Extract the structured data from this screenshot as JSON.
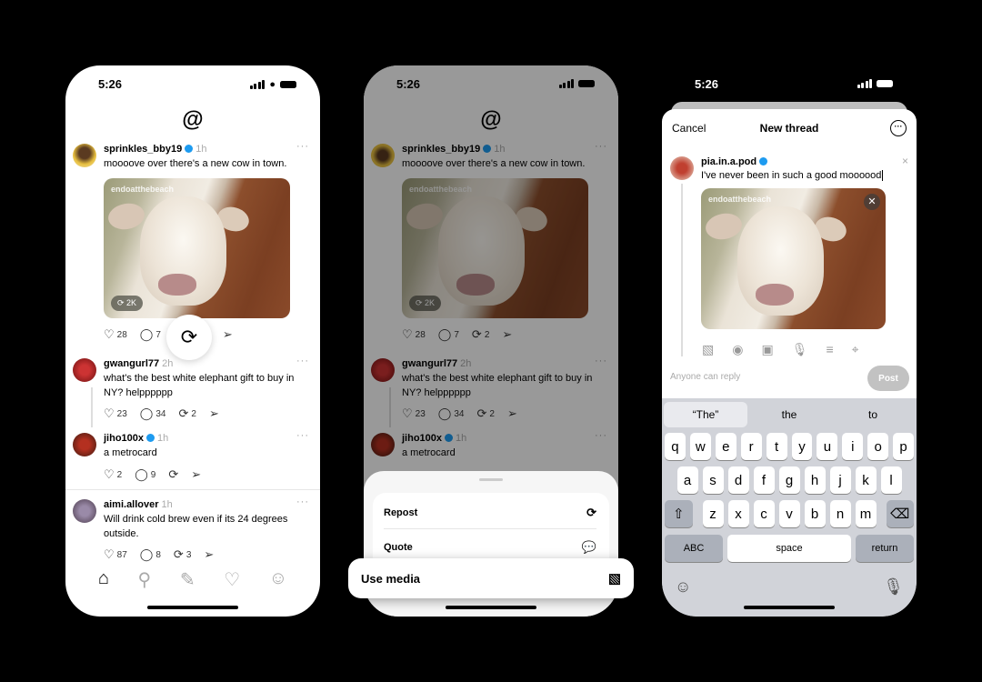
{
  "status_time": "5:26",
  "feed": {
    "posts": [
      {
        "user": "sprinkles_bby19",
        "verified": true,
        "time": "1h",
        "text": "moooove over there's a new cow in town.",
        "media_watermark": "endoatthebeach",
        "media_badge": "2K",
        "likes": "28",
        "replies": "7",
        "reposts": "2"
      },
      {
        "user": "gwangurl77",
        "verified": false,
        "time": "2h",
        "text": "what's the best white elephant gift to buy in NY? helpppppp",
        "likes": "23",
        "replies": "34",
        "reposts": "2"
      },
      {
        "user": "jiho100x",
        "verified": true,
        "time": "1h",
        "text": "a metrocard",
        "likes": "2",
        "replies": "9",
        "reposts": ""
      },
      {
        "user": "aimi.allover",
        "verified": false,
        "time": "1h",
        "text": "Will drink cold brew even if its 24 degrees outside.",
        "likes": "87",
        "replies": "8",
        "reposts": "3"
      }
    ],
    "tabs": [
      "home",
      "search",
      "compose",
      "activity",
      "profile"
    ]
  },
  "repost_sheet": {
    "items": [
      "Repost",
      "Quote"
    ],
    "highlighted": "Use media"
  },
  "compose": {
    "cancel": "Cancel",
    "title": "New thread",
    "user": "pia.in.a.pod",
    "text": "I've never been in such a good moooood",
    "media_watermark": "endoatthebeach",
    "reply_setting": "Anyone can reply",
    "post_label": "Post",
    "suggestions": [
      "“The”",
      "the",
      "to"
    ],
    "rows": [
      [
        "q",
        "w",
        "e",
        "r",
        "t",
        "y",
        "u",
        "i",
        "o",
        "p"
      ],
      [
        "a",
        "s",
        "d",
        "f",
        "g",
        "h",
        "j",
        "k",
        "l"
      ],
      [
        "z",
        "x",
        "c",
        "v",
        "b",
        "n",
        "m"
      ]
    ],
    "abc": "ABC",
    "space": "space",
    "return": "return"
  }
}
